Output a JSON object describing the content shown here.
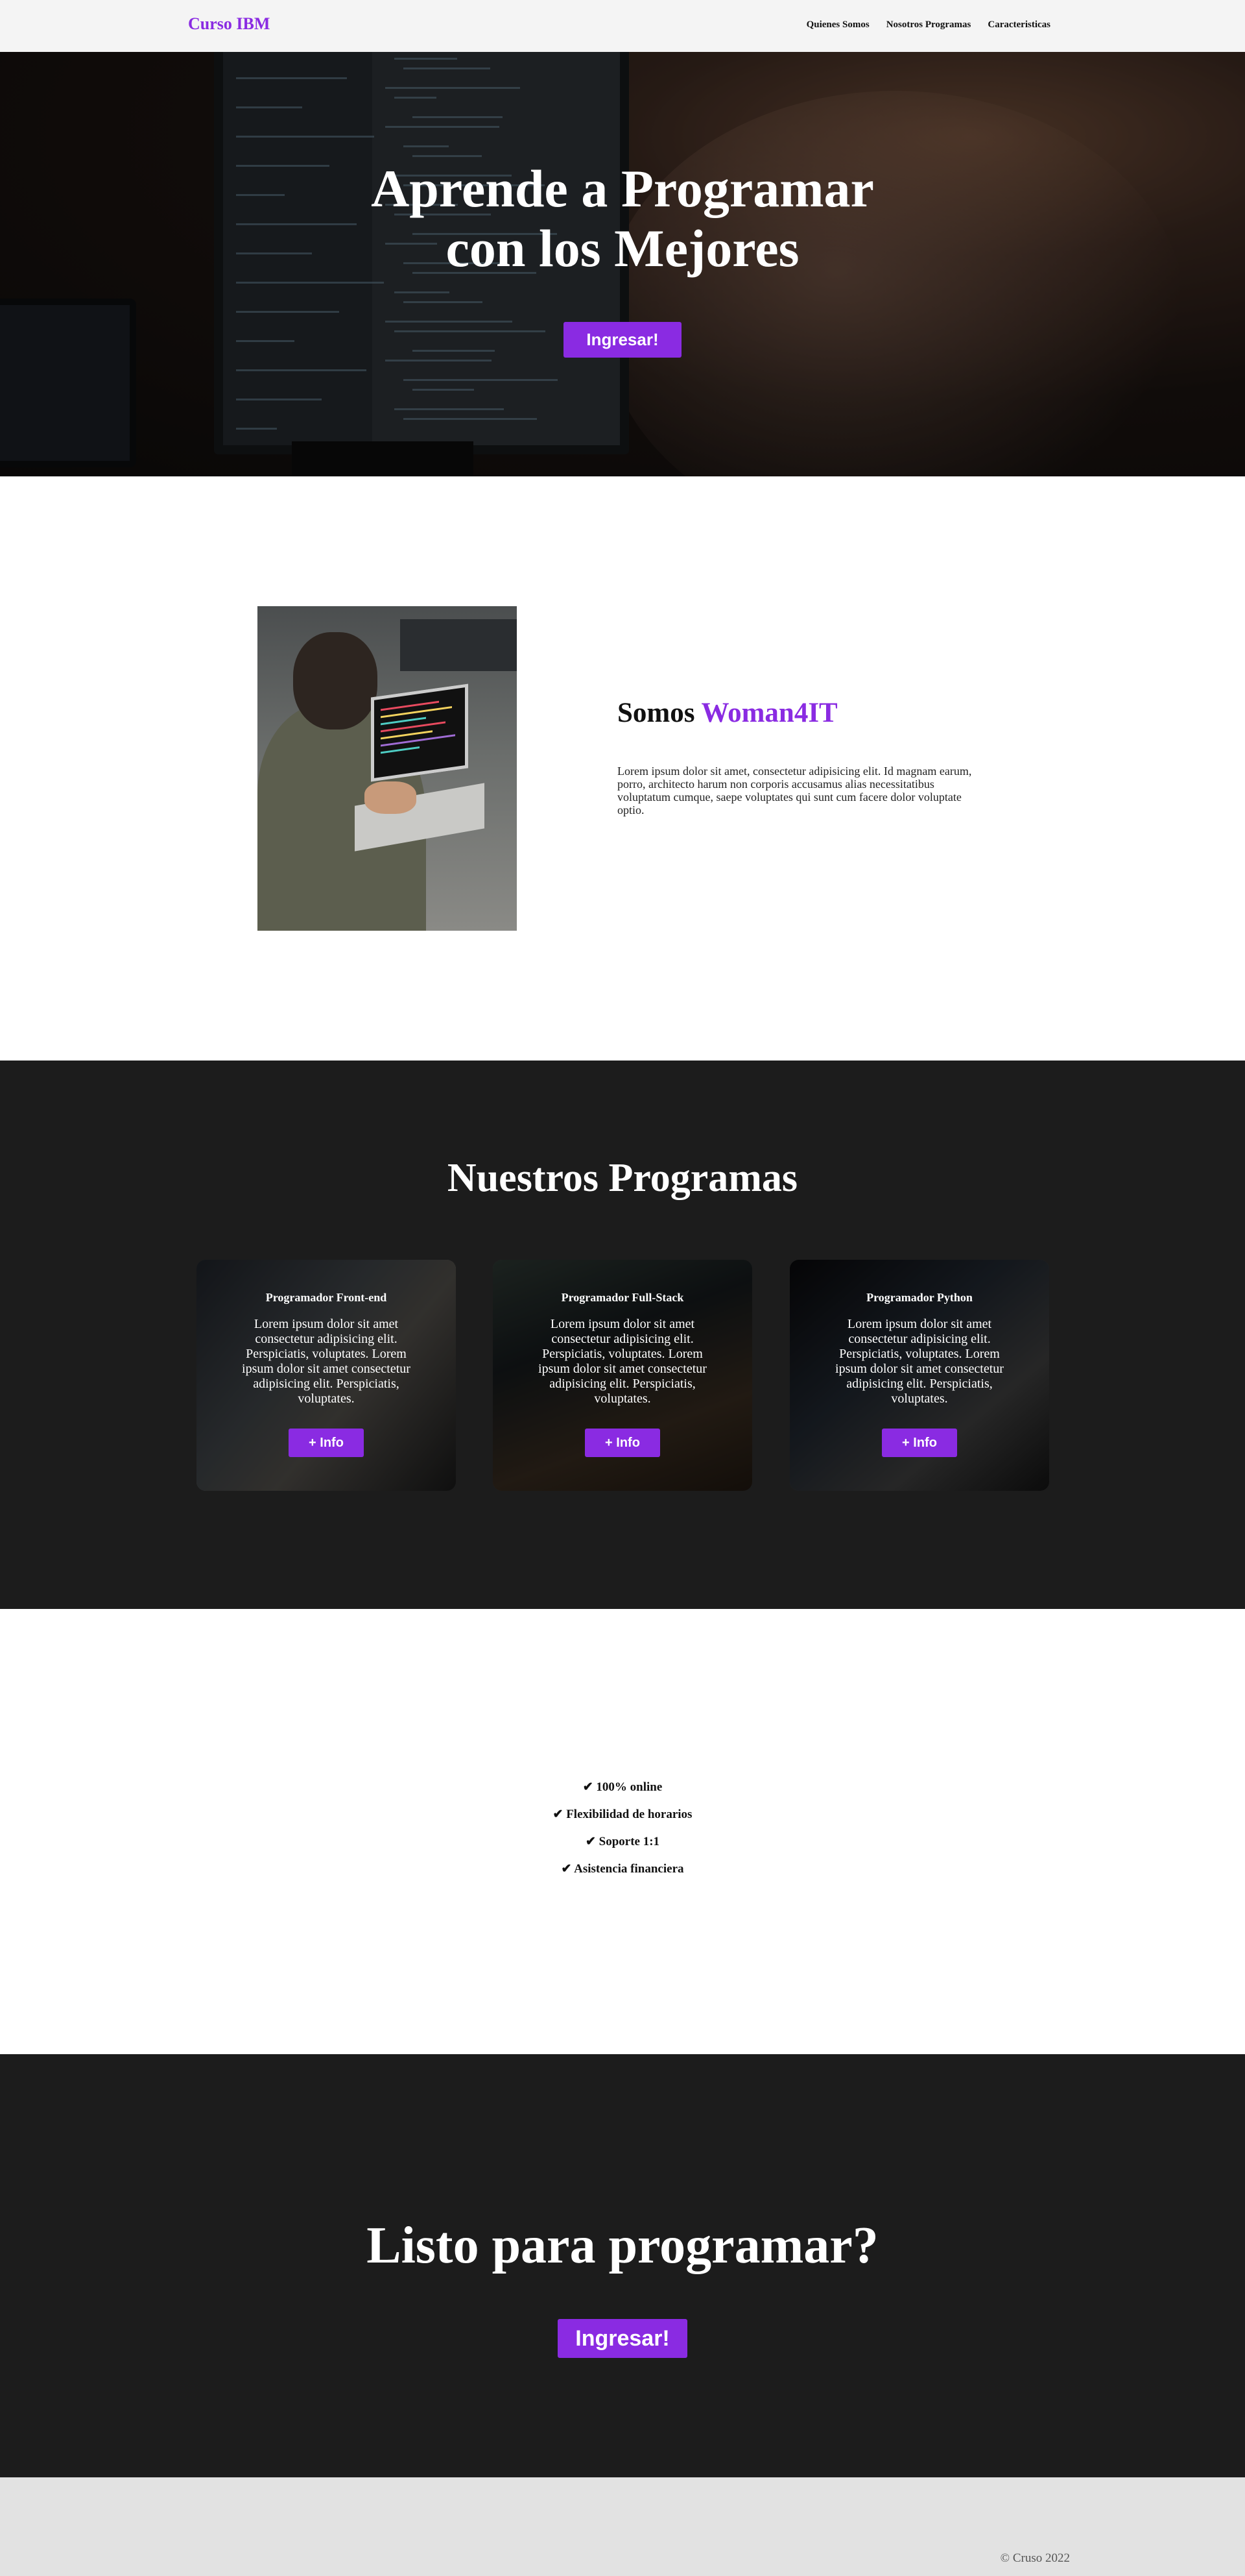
{
  "navbar": {
    "brand": "Curso IBM",
    "links": [
      "Quienes Somos",
      "Nosotros Programas",
      "Caracteristicas"
    ]
  },
  "hero": {
    "title_line1": "Aprende a Programar",
    "title_line2": "con los Mejores",
    "button": "Ingresar!"
  },
  "about": {
    "title_prefix": "Somos",
    "title_accent": "Woman4IT",
    "text": "Lorem ipsum dolor sit amet, consectetur adipisicing elit. Id magnam earum, porro, architecto harum non corporis accusamus alias necessitatibus voluptatum cumque, saepe voluptates qui sunt cum facere dolor voluptate optio."
  },
  "programs": {
    "title": "Nuestros Programas",
    "cards": [
      {
        "title": "Programador Front-end",
        "text": "Lorem ipsum dolor sit amet consectetur adipisicing elit. Perspiciatis, voluptates. Lorem ipsum dolor sit amet consectetur adipisicing elit. Perspiciatis, voluptates.",
        "button": "+ Info"
      },
      {
        "title": "Programador Full-Stack",
        "text": "Lorem ipsum dolor sit amet consectetur adipisicing elit. Perspiciatis, voluptates. Lorem ipsum dolor sit amet consectetur adipisicing elit. Perspiciatis, voluptates.",
        "button": "+ Info"
      },
      {
        "title": "Programador Python",
        "text": "Lorem ipsum dolor sit amet consectetur adipisicing elit. Perspiciatis, voluptates. Lorem ipsum dolor sit amet consectetur adipisicing elit. Perspiciatis, voluptates.",
        "button": "+ Info"
      }
    ]
  },
  "features": {
    "items": [
      "✔ 100% online",
      "✔ Flexibilidad de horarios",
      "✔ Soporte 1:1",
      "✔ Asistencia financiera"
    ]
  },
  "cta": {
    "title": "Listo para programar?",
    "button": "Ingresar!"
  },
  "footer": {
    "copyright": "© Cruso 2022"
  },
  "colors": {
    "accent": "#8a2be2",
    "dark_section": "#1c1c1c",
    "navbar_bg": "#f4f4f4",
    "footer_bg": "#e2e2e2"
  }
}
